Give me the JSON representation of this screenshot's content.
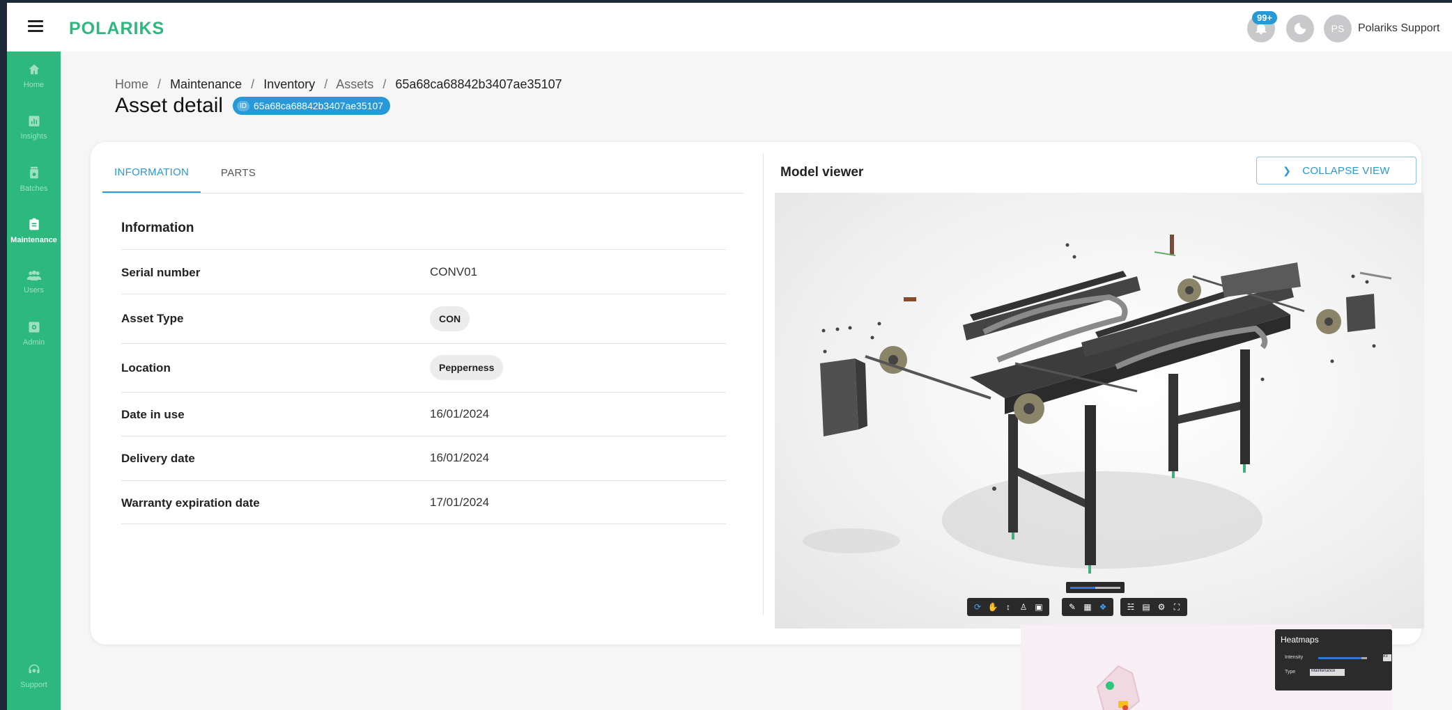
{
  "app": {
    "logo_text": "POLARIKS",
    "brand_color": "#2db87d",
    "accent_color": "#2798d8"
  },
  "topbar": {
    "notifications_count": "99+",
    "user_initials": "PS",
    "user_name": "Polariks Support",
    "icons": [
      "menu-icon",
      "bell-icon",
      "moon-icon"
    ]
  },
  "sidebar": {
    "items": [
      {
        "label": "Home",
        "icon": "home-icon",
        "active": false
      },
      {
        "label": "Insights",
        "icon": "chart-icon",
        "active": false
      },
      {
        "label": "Batches",
        "icon": "batch-icon",
        "active": false
      },
      {
        "label": "Maintenance",
        "icon": "clipboard-icon",
        "active": true
      },
      {
        "label": "Users",
        "icon": "users-icon",
        "active": false
      },
      {
        "label": "Admin",
        "icon": "admin-icon",
        "active": false
      }
    ],
    "support_label": "Support"
  },
  "breadcrumb": {
    "items": [
      "Home",
      "Maintenance",
      "Inventory",
      "Assets",
      "65a68ca68842b3407ae35107"
    ],
    "separator": "/"
  },
  "page": {
    "title": "Asset detail",
    "id_label": "ID",
    "id_value": "65a68ca68842b3407ae35107"
  },
  "tabs": [
    {
      "label": "INFORMATION",
      "active": true
    },
    {
      "label": "PARTS",
      "active": false
    }
  ],
  "information": {
    "title": "Information",
    "rows": [
      {
        "key": "Serial number",
        "value": "CONV01",
        "type": "text"
      },
      {
        "key": "Asset Type",
        "value": "CON",
        "type": "chip"
      },
      {
        "key": "Location",
        "value": "Pepperness",
        "type": "chip"
      },
      {
        "key": "Date in use",
        "value": "16/01/2024",
        "type": "text"
      },
      {
        "key": "Delivery date",
        "value": "16/01/2024",
        "type": "text"
      },
      {
        "key": "Warranty expiration date",
        "value": "17/01/2024",
        "type": "text"
      }
    ]
  },
  "model_viewer": {
    "title": "Model viewer",
    "collapse_label": "COLLAPSE VIEW",
    "toolbar_icons": [
      "orbit-icon",
      "pan-icon",
      "zoom-icon",
      "walk-icon",
      "camera-icon",
      "measure-icon",
      "section-icon",
      "explode-icon",
      "tree-icon",
      "properties-icon",
      "settings-icon",
      "fullscreen-icon"
    ],
    "explode_level": 0.45
  },
  "heatmaps_panel": {
    "title": "Heatmaps",
    "intensity_label": "Intensity",
    "type_label": "Type",
    "type_value": "Maintenance",
    "intensity_value": "83"
  }
}
